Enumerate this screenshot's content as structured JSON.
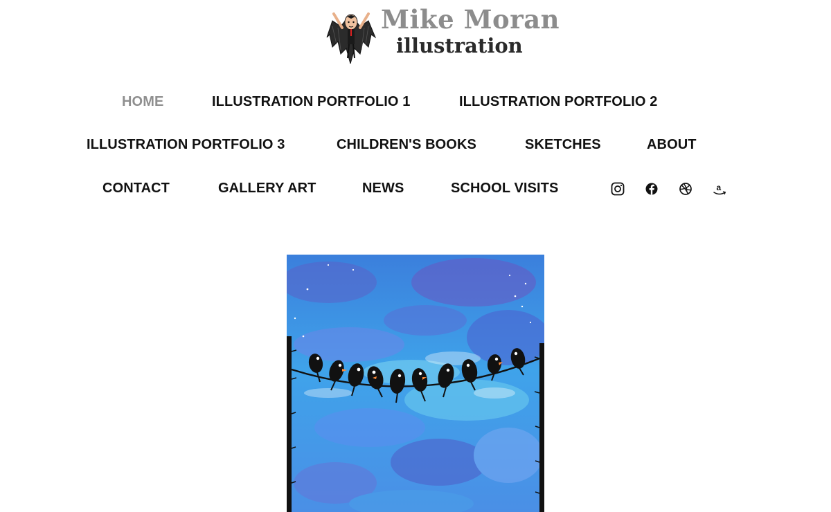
{
  "logo": {
    "name": "Mike Moran",
    "subtitle": "illustration"
  },
  "nav": {
    "home": "HOME",
    "portfolio1": "ILLUSTRATION PORTFOLIO 1",
    "portfolio2": "ILLUSTRATION PORTFOLIO 2",
    "portfolio3": "ILLUSTRATION PORTFOLIO 3",
    "childrens_books": "CHILDREN'S BOOKS",
    "sketches": "SKETCHES",
    "about": "ABOUT",
    "contact": "CONTACT",
    "gallery_art": "GALLERY ART",
    "news": "NEWS",
    "school_visits": "SCHOOL VISITS"
  },
  "social": [
    "instagram-icon",
    "facebook-icon",
    "dribbble-icon",
    "amazon-icon"
  ],
  "colors": {
    "nav_text": "#111111",
    "nav_active": "#8f8f8f",
    "sky_blue": "#3f8fe0",
    "sky_purple": "#5f63c8"
  },
  "artwork": {
    "subject": "birds-on-a-wire-illustration"
  }
}
